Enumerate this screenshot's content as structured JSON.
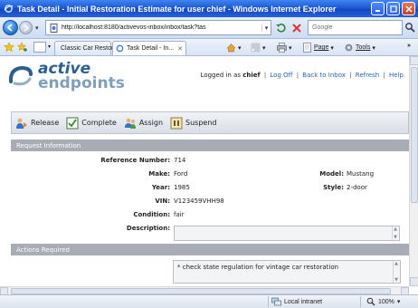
{
  "window": {
    "title": "Task Detail - Initial Restoration Estimate for user chief - Windows Internet Explorer"
  },
  "address_bar": {
    "url": "http://localhost:8180/activevos-inbox/inbox/task?tas",
    "search_placeholder": "Google"
  },
  "tabs": [
    {
      "label": "Classic Car Restor...",
      "active": false
    },
    {
      "label": "Task Detail - In...",
      "active": true
    }
  ],
  "command_bar": {
    "page_label": "Page",
    "tools_label": "Tools"
  },
  "app": {
    "logo_line1": "active",
    "logo_line2": "endpoints",
    "logged_in_prefix": "Logged in as ",
    "user": "chief",
    "links": [
      "Log Off",
      "Back to Inbox",
      "Refresh",
      "Help"
    ]
  },
  "toolbar": {
    "release_label": "Release",
    "complete_label": "Complete",
    "assign_label": "Assign",
    "suspend_label": "Suspend"
  },
  "request_info": {
    "header": "Request Information",
    "reference_label": "Reference Number:",
    "reference_value": "714",
    "make_label": "Make:",
    "make_value": "Ford",
    "model_label": "Model:",
    "model_value": "Mustang",
    "year_label": "Year:",
    "year_value": "1985",
    "style_label": "Style:",
    "style_value": "2-door",
    "vin_label": "VIN:",
    "vin_value": "V123459VHH98",
    "condition_label": "Condition:",
    "condition_value": "fair",
    "description_label": "Description:",
    "description_value": ""
  },
  "actions_required": {
    "header": "Actions Required",
    "text": "* check state regulation for vintage car restoration"
  },
  "status_bar": {
    "zone": "Local intranet",
    "zoom": "100%"
  },
  "colors": {
    "titlebar": "#1d5ad6",
    "section_header": "#a8adb5",
    "link": "#2b63b5"
  }
}
